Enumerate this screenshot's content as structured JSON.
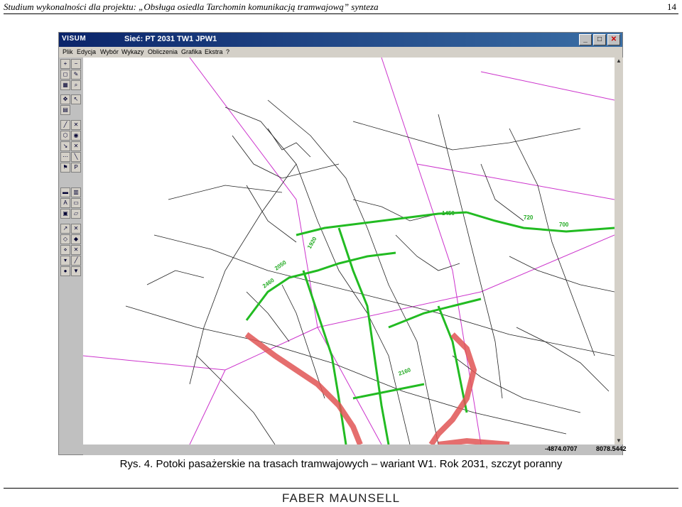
{
  "header": {
    "title": "Studium wykonalności dla projektu: „Obsługa osiedla Tarchomin komunikacją tramwajową” synteza",
    "page_number": "14"
  },
  "window": {
    "app_logo": "VISUM",
    "network_title": "Sieć: PT 2031 TW1 JPW1",
    "buttons": {
      "minimize": "_",
      "maximize": "□",
      "close": "✕"
    },
    "menu": [
      "Plik",
      "Edycja",
      "Wybór",
      "Wykazy",
      "Obliczenia",
      "Grafika",
      "Ekstra",
      "?"
    ],
    "status": {
      "x_coord": "-4874.0707",
      "y_coord": "8078.5442"
    }
  },
  "map": {
    "colors": {
      "roads": "#222222",
      "boundaries": "#cc33cc",
      "tram_flow": "#22bb22",
      "high_flow": "#e05555",
      "labels": "#22aa22"
    },
    "flow_labels": [
      "720",
      "700",
      "2460",
      "2050",
      "2160",
      "1450",
      "1920"
    ]
  },
  "caption": "Rys. 4. Potoki pasażerskie na trasach tramwajowych – wariant W1. Rok 2031, szczyt poranny",
  "footer": {
    "logo": "FABER MAUNSELL"
  }
}
